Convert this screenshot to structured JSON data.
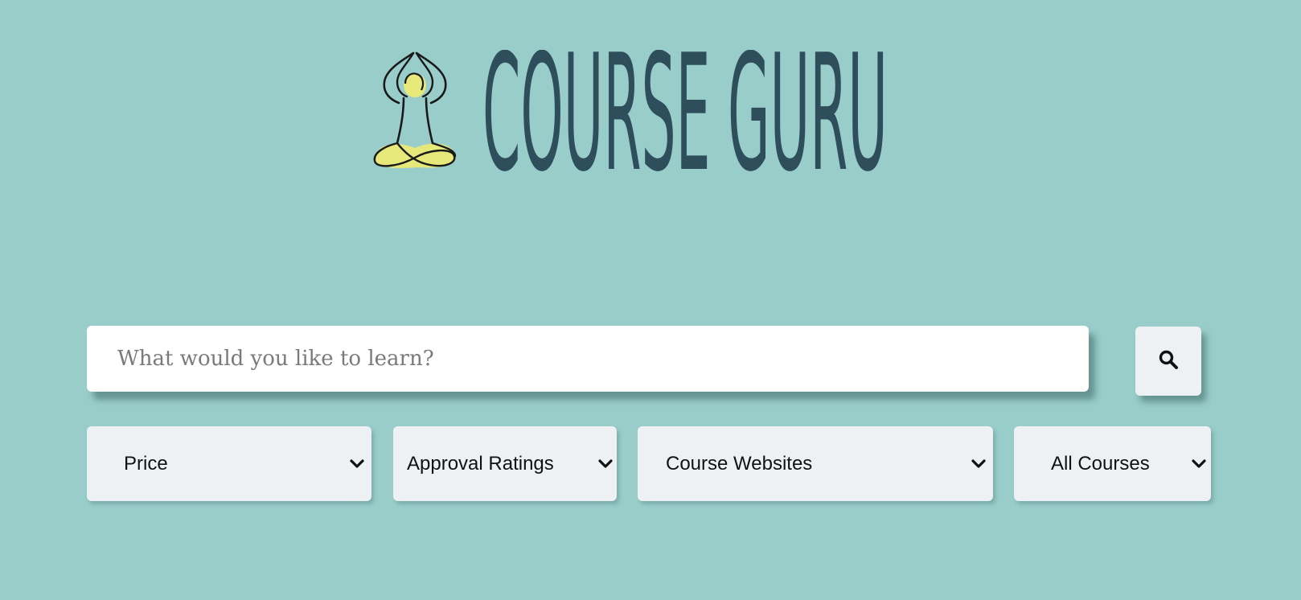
{
  "brand": {
    "name": "COURSE GURU",
    "logo_icon": "meditating-figure-icon",
    "text_color": "#2e4e5c",
    "accent_color": "#e6e87a"
  },
  "search": {
    "placeholder": "What would you like to learn?",
    "value": "",
    "button_icon": "search-icon"
  },
  "filters": [
    {
      "label": "Price",
      "icon": "chevron-down-icon"
    },
    {
      "label": "Approval Ratings",
      "icon": "chevron-down-icon"
    },
    {
      "label": "Course Websites",
      "icon": "chevron-down-icon"
    },
    {
      "label": "All Courses",
      "icon": "chevron-down-icon"
    }
  ],
  "colors": {
    "background": "#99cdca",
    "control_bg": "#eef1f3",
    "input_bg": "#ffffff"
  }
}
